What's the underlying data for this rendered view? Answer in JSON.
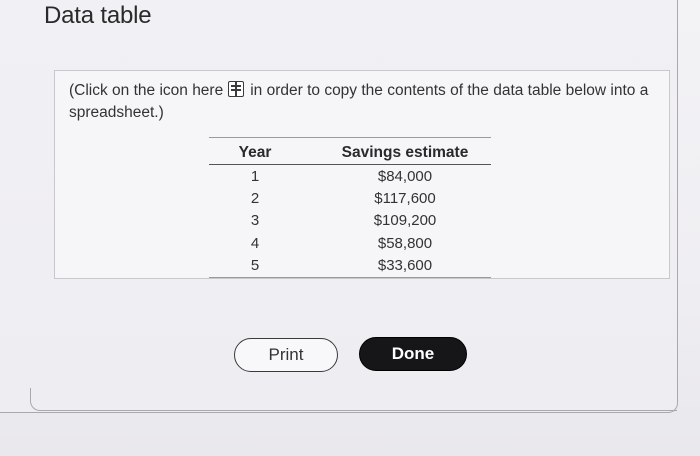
{
  "dialog": {
    "title": "Data table",
    "note_before_icon": "(Click on the icon here",
    "note_after_icon": "in order to copy the contents of the data table below into a spreadsheet.)",
    "copy_icon": "copy-to-spreadsheet-icon"
  },
  "table": {
    "headers": {
      "year": "Year",
      "savings": "Savings estimate"
    },
    "rows": [
      {
        "year": "1",
        "savings": "$84,000"
      },
      {
        "year": "2",
        "savings": "$117,600"
      },
      {
        "year": "3",
        "savings": "$109,200"
      },
      {
        "year": "4",
        "savings": "$58,800"
      },
      {
        "year": "5",
        "savings": "$33,600"
      }
    ]
  },
  "buttons": {
    "print": "Print",
    "done": "Done"
  },
  "colors": {
    "background": "#efeef2",
    "done_button": "#161618",
    "border": "#a9a8ad"
  }
}
